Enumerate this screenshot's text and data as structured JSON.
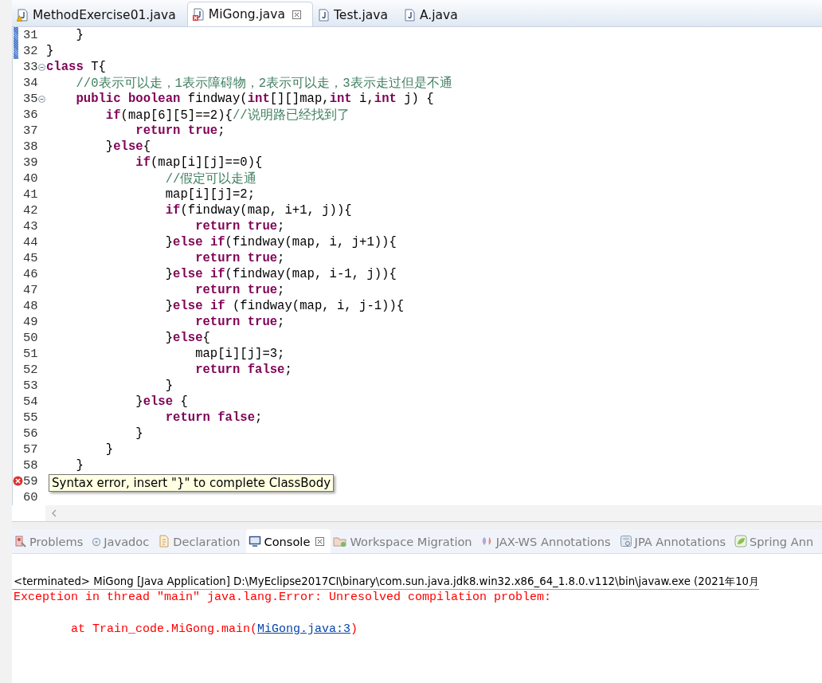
{
  "editor_tabs": [
    {
      "label": "MethodExercise01.java",
      "warning": true,
      "error": false,
      "selected": false,
      "closable": false
    },
    {
      "label": "MiGong.java",
      "warning": false,
      "error": true,
      "selected": true,
      "closable": true
    },
    {
      "label": "Test.java",
      "warning": false,
      "error": false,
      "selected": false,
      "closable": false
    },
    {
      "label": "A.java",
      "warning": false,
      "error": false,
      "selected": false,
      "closable": false
    }
  ],
  "lines": [
    {
      "number": "31",
      "changed": true,
      "foldable": false,
      "error": false,
      "segments": [
        {
          "kind": "tx",
          "text": "    }"
        }
      ]
    },
    {
      "number": "32",
      "changed": true,
      "foldable": false,
      "error": false,
      "segments": [
        {
          "kind": "tx",
          "text": "}"
        }
      ]
    },
    {
      "number": "33",
      "changed": false,
      "foldable": true,
      "error": false,
      "segments": [
        {
          "kind": "kw",
          "text": "class"
        },
        {
          "kind": "tx",
          "text": " T{"
        }
      ]
    },
    {
      "number": "34",
      "changed": false,
      "foldable": false,
      "error": false,
      "segments": [
        {
          "kind": "cm",
          "text": "    //0表示可以走，1表示障碍物，2表示可以走，3表示走过但是不通"
        }
      ]
    },
    {
      "number": "35",
      "changed": false,
      "foldable": true,
      "error": false,
      "segments": [
        {
          "kind": "kw",
          "text": "    public boolean"
        },
        {
          "kind": "tx",
          "text": " findway("
        },
        {
          "kind": "kw",
          "text": "int"
        },
        {
          "kind": "tx",
          "text": "[][]map,"
        },
        {
          "kind": "kw",
          "text": "int"
        },
        {
          "kind": "tx",
          "text": " i,"
        },
        {
          "kind": "kw",
          "text": "int"
        },
        {
          "kind": "tx",
          "text": " j) {"
        }
      ]
    },
    {
      "number": "36",
      "changed": false,
      "foldable": false,
      "error": false,
      "segments": [
        {
          "kind": "kw",
          "text": "        if"
        },
        {
          "kind": "tx",
          "text": "(map[6][5]==2){"
        },
        {
          "kind": "cm",
          "text": "//说明路已经找到了"
        }
      ]
    },
    {
      "number": "37",
      "changed": false,
      "foldable": false,
      "error": false,
      "segments": [
        {
          "kind": "kw",
          "text": "            return true"
        },
        {
          "kind": "tx",
          "text": ";"
        }
      ]
    },
    {
      "number": "38",
      "changed": false,
      "foldable": false,
      "error": false,
      "segments": [
        {
          "kind": "tx",
          "text": "        }"
        },
        {
          "kind": "kw",
          "text": "else"
        },
        {
          "kind": "tx",
          "text": "{"
        }
      ]
    },
    {
      "number": "39",
      "changed": false,
      "foldable": false,
      "error": false,
      "segments": [
        {
          "kind": "kw",
          "text": "            if"
        },
        {
          "kind": "tx",
          "text": "(map[i][j]==0){"
        }
      ]
    },
    {
      "number": "40",
      "changed": false,
      "foldable": false,
      "error": false,
      "segments": [
        {
          "kind": "cm",
          "text": "                //假定可以走通"
        }
      ]
    },
    {
      "number": "41",
      "changed": false,
      "foldable": false,
      "error": false,
      "segments": [
        {
          "kind": "tx",
          "text": "                map[i][j]=2;"
        }
      ]
    },
    {
      "number": "42",
      "changed": false,
      "foldable": false,
      "error": false,
      "segments": [
        {
          "kind": "kw",
          "text": "                if"
        },
        {
          "kind": "tx",
          "text": "(findway(map, i+1, j)){"
        }
      ]
    },
    {
      "number": "43",
      "changed": false,
      "foldable": false,
      "error": false,
      "segments": [
        {
          "kind": "kw",
          "text": "                    return true"
        },
        {
          "kind": "tx",
          "text": ";"
        }
      ]
    },
    {
      "number": "44",
      "changed": false,
      "foldable": false,
      "error": false,
      "segments": [
        {
          "kind": "tx",
          "text": "                }"
        },
        {
          "kind": "kw",
          "text": "else if"
        },
        {
          "kind": "tx",
          "text": "(findway(map, i, j+1)){"
        }
      ]
    },
    {
      "number": "45",
      "changed": false,
      "foldable": false,
      "error": false,
      "segments": [
        {
          "kind": "kw",
          "text": "                    return true"
        },
        {
          "kind": "tx",
          "text": ";"
        }
      ]
    },
    {
      "number": "46",
      "changed": false,
      "foldable": false,
      "error": false,
      "segments": [
        {
          "kind": "tx",
          "text": "                }"
        },
        {
          "kind": "kw",
          "text": "else if"
        },
        {
          "kind": "tx",
          "text": "(findway(map, i-1, j)){"
        }
      ]
    },
    {
      "number": "47",
      "changed": false,
      "foldable": false,
      "error": false,
      "segments": [
        {
          "kind": "kw",
          "text": "                    return true"
        },
        {
          "kind": "tx",
          "text": ";"
        }
      ]
    },
    {
      "number": "48",
      "changed": false,
      "foldable": false,
      "error": false,
      "segments": [
        {
          "kind": "tx",
          "text": "                }"
        },
        {
          "kind": "kw",
          "text": "else if"
        },
        {
          "kind": "tx",
          "text": " (findway(map, i, j-1)){"
        }
      ]
    },
    {
      "number": "49",
      "changed": false,
      "foldable": false,
      "error": false,
      "segments": [
        {
          "kind": "kw",
          "text": "                    return true"
        },
        {
          "kind": "tx",
          "text": ";"
        }
      ]
    },
    {
      "number": "50",
      "changed": false,
      "foldable": false,
      "error": false,
      "segments": [
        {
          "kind": "tx",
          "text": "                }"
        },
        {
          "kind": "kw",
          "text": "else"
        },
        {
          "kind": "tx",
          "text": "{"
        }
      ]
    },
    {
      "number": "51",
      "changed": false,
      "foldable": false,
      "error": false,
      "segments": [
        {
          "kind": "tx",
          "text": "                    map[i][j]=3;"
        }
      ]
    },
    {
      "number": "52",
      "changed": false,
      "foldable": false,
      "error": false,
      "segments": [
        {
          "kind": "kw",
          "text": "                    return false"
        },
        {
          "kind": "tx",
          "text": ";"
        }
      ]
    },
    {
      "number": "53",
      "changed": false,
      "foldable": false,
      "error": false,
      "segments": [
        {
          "kind": "tx",
          "text": "                }"
        }
      ]
    },
    {
      "number": "54",
      "changed": false,
      "foldable": false,
      "error": false,
      "segments": [
        {
          "kind": "tx",
          "text": "            }"
        },
        {
          "kind": "kw",
          "text": "else"
        },
        {
          "kind": "tx",
          "text": " {"
        }
      ]
    },
    {
      "number": "55",
      "changed": false,
      "foldable": false,
      "error": false,
      "segments": [
        {
          "kind": "kw",
          "text": "                return false"
        },
        {
          "kind": "tx",
          "text": ";"
        }
      ]
    },
    {
      "number": "56",
      "changed": false,
      "foldable": false,
      "error": false,
      "segments": [
        {
          "kind": "tx",
          "text": "            }"
        }
      ]
    },
    {
      "number": "57",
      "changed": false,
      "foldable": false,
      "error": false,
      "segments": [
        {
          "kind": "tx",
          "text": "        }"
        }
      ]
    },
    {
      "number": "58",
      "changed": false,
      "foldable": false,
      "error": false,
      "segments": [
        {
          "kind": "tx",
          "text": "    }"
        }
      ]
    },
    {
      "number": "59",
      "changed": false,
      "foldable": false,
      "error": true
    },
    {
      "number": "60",
      "changed": false,
      "foldable": false,
      "error": false
    }
  ],
  "tooltip": "Syntax error, insert \"}\" to complete ClassBody",
  "panel_tabs": [
    {
      "label": "Problems",
      "kind": "problems",
      "selected": false,
      "closable": false
    },
    {
      "label": "Javadoc",
      "kind": "javadoc",
      "selected": false,
      "closable": false
    },
    {
      "label": "Declaration",
      "kind": "declaration",
      "selected": false,
      "closable": false
    },
    {
      "label": "Console",
      "kind": "console",
      "selected": true,
      "closable": true
    },
    {
      "label": "Workspace Migration",
      "kind": "migration",
      "selected": false,
      "closable": false
    },
    {
      "label": "JAX-WS Annotations",
      "kind": "jaxws",
      "selected": false,
      "closable": false
    },
    {
      "label": "JPA Annotations",
      "kind": "jpa",
      "selected": false,
      "closable": false
    },
    {
      "label": "Spring Ann",
      "kind": "spring",
      "selected": false,
      "closable": false
    }
  ],
  "console": {
    "header": "<terminated> MiGong [Java Application] D:\\MyEclipse2017CI\\binary\\com.sun.java.jdk8.win32.x86_64_1.8.0.v112\\bin\\javaw.exe (2021年10月",
    "error_line": "Exception in thread \"main\" java.lang.Error: Unresolved compilation problem:",
    "trace_prefix": "        at Train_code.MiGong.main(",
    "trace_link": "MiGong.java:3",
    "trace_suffix": ")"
  }
}
